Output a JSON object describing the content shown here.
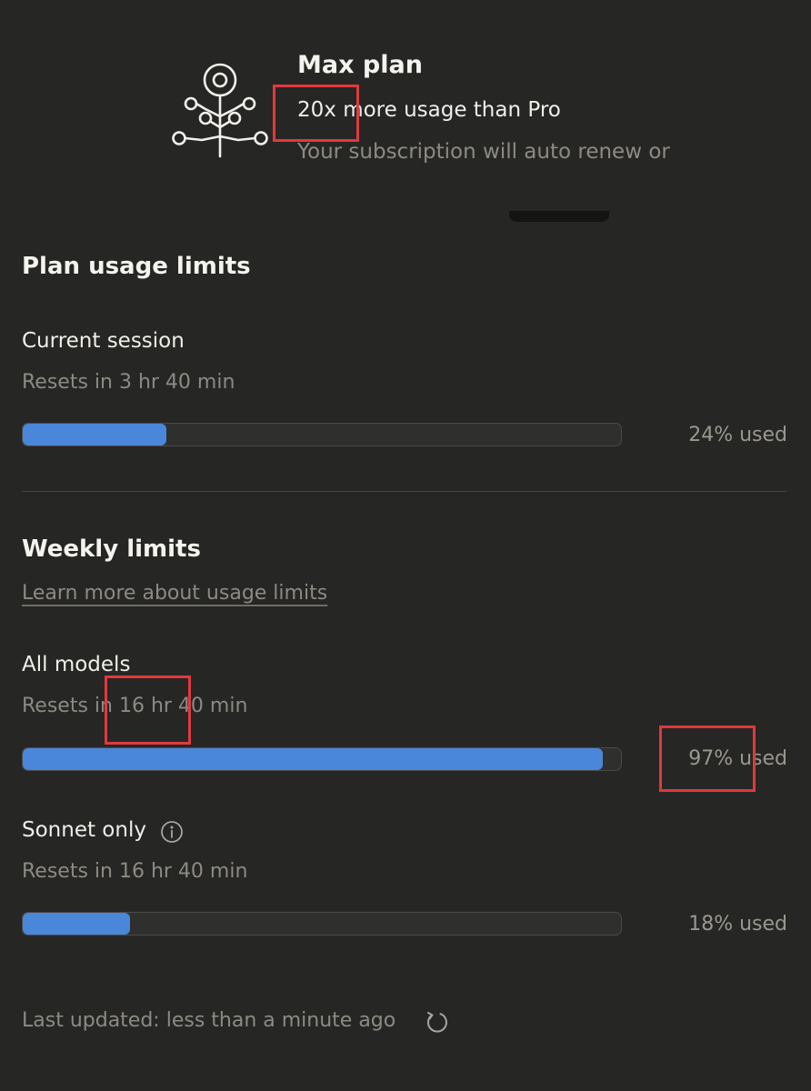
{
  "plan": {
    "title": "Max plan",
    "subtitle": "20x more usage than Pro",
    "renewal_note": "Your subscription will auto renew or",
    "icon": "plan-tree-icon"
  },
  "plan_usage": {
    "title": "Plan usage limits",
    "current_session": {
      "label": "Current session",
      "reset": "Resets in 3 hr 40 min",
      "percent": 24,
      "used_label": "24% used"
    }
  },
  "weekly": {
    "title": "Weekly limits",
    "learn_more": "Learn more about usage limits",
    "all_models": {
      "label": "All models",
      "reset": "Resets in 16 hr 40 min",
      "percent": 97,
      "used_label": "97% used"
    },
    "sonnet_only": {
      "label": "Sonnet only",
      "reset": "Resets in 16 hr 40 min",
      "percent": 18,
      "used_label": "18% used",
      "icon": "info-icon"
    }
  },
  "footer": {
    "last_updated": "Last updated: less than a minute ago",
    "icon": "refresh-icon"
  },
  "colors": {
    "background": "#262624",
    "bar_fill": "#4a86d9",
    "bar_track": "#2f2f2d",
    "highlight": "#e0393e"
  }
}
